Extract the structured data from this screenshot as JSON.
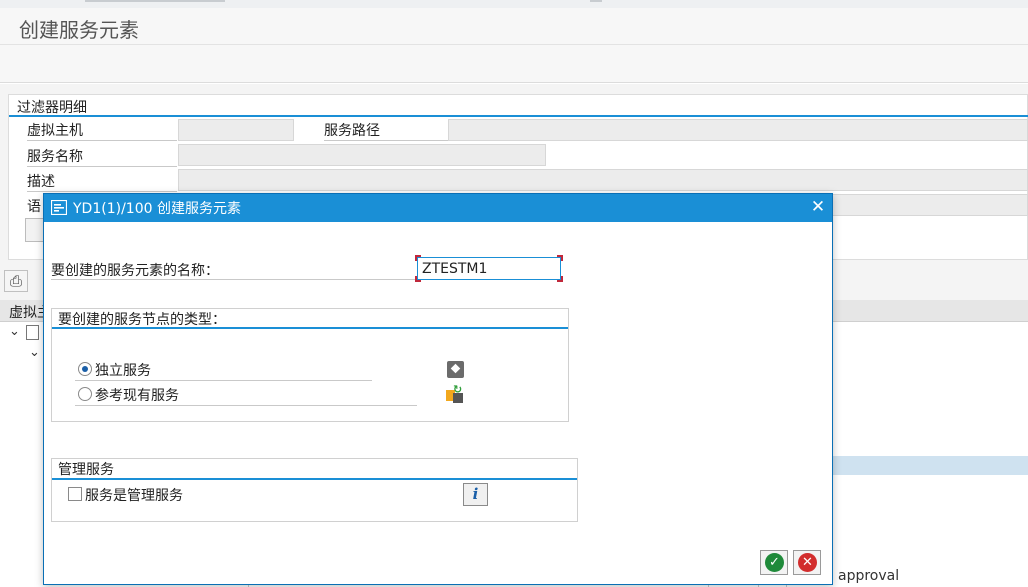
{
  "window": {
    "title": "创建服务元素"
  },
  "filter": {
    "title": "过滤器明细",
    "virtual_host_label": "虚拟主机",
    "service_path_label": "服务路径",
    "service_name_label": "服务名称",
    "description_label": "描述",
    "language_label_partial": "语"
  },
  "tree": {
    "header_partial": "虚拟主",
    "approval_text": "approval"
  },
  "dialog": {
    "title": "YD1(1)/100 创建服务元素",
    "close_glyph": "✕",
    "name_label": "要创建的服务元素的名称：",
    "name_value": "ZTESTM1",
    "type_group_title": "要创建的服务节点的类型：",
    "options": [
      {
        "label": "独立服务",
        "selected": true,
        "icon": "cube-icon"
      },
      {
        "label": "参考现有服务",
        "selected": false,
        "icon": "reference-service-icon"
      }
    ],
    "mgmt_group_title": "管理服务",
    "mgmt_checkbox_label": "服务是管理服务",
    "mgmt_checked": false,
    "info_glyph": "i",
    "ok_glyph": "✓",
    "cancel_glyph": "✕"
  },
  "colors": {
    "accent": "#1a8fd6",
    "selection": "#cfe2f0",
    "ok": "#1f8a3a",
    "cancel": "#d22d2d"
  }
}
